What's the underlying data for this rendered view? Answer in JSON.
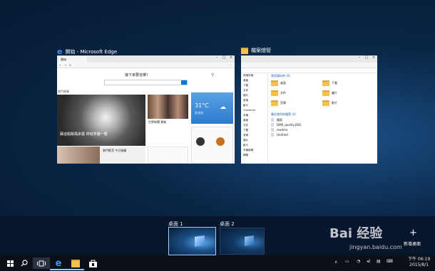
{
  "edge_window": {
    "title": "開始 - Microsoft Edge",
    "tab_label": "開始",
    "search_heading": "接下來要去哪?",
    "section_label": "熱門故事",
    "hero_caption": "蘇迪勒颱風來襲 停班停課一覽",
    "story_caption": "世界新聞 焦點",
    "bottom_caption": "熱門影音 今日推薦",
    "weather_temp": "31°C",
    "weather_city": "台北市"
  },
  "explorer_window": {
    "title": "檔案總管",
    "frequent_folders_label": "常用資料夾 (6)",
    "recent_files_label": "最近使用的檔案 (4)",
    "nav_items": [
      "快速存取",
      "桌面",
      "下載",
      "文件",
      "圖片",
      "音樂",
      "影片",
      "OneDrive",
      "本機",
      "桌面",
      "文件",
      "下載",
      "音樂",
      "圖片",
      "影片",
      "本機磁碟",
      "網路"
    ],
    "folders": [
      "桌面",
      "下載",
      "文件",
      "圖片",
      "音樂",
      "影片"
    ],
    "recent_files": [
      "檔案",
      "DMR_quality.DSD",
      "readme",
      "Untitled"
    ]
  },
  "desktops": {
    "desktop1_label": "桌面 1",
    "desktop2_label": "桌面 2",
    "new_desktop_label": "新增桌面"
  },
  "taskbar": {
    "time": "下午 06:19",
    "date": "2015/8/1"
  },
  "watermark": {
    "text": "Bai 经验",
    "url": "jingyan.baidu.com"
  },
  "colors": {
    "accent": "#0078d7",
    "selected_desktop_border": "#9fc9ff"
  }
}
